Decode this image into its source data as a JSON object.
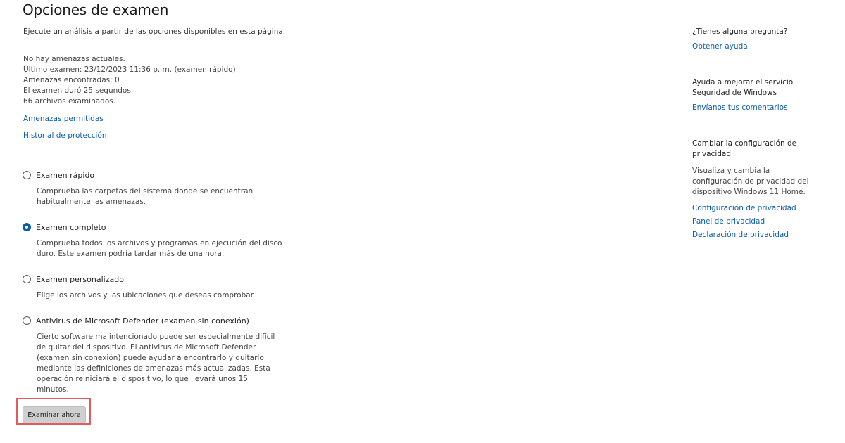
{
  "header": {
    "title": "Opciones de examen",
    "subtitle": "Ejecute un análisis a partir de las opciones disponibles en esta página."
  },
  "status": {
    "lines": [
      "No hay amenazas actuales.",
      "Último examen: 23/12/2023 11:36 p. m. (examen rápido)",
      "Amenazas encontradas: 0",
      "El examen duró 25 segundos",
      "66 archivos examinados."
    ]
  },
  "links": {
    "allowed_threats": "Amenazas permitidas",
    "protection_history": "Historial de protección"
  },
  "scan_options": [
    {
      "label": "Examen rápido",
      "description": "Comprueba las carpetas del sistema donde se encuentran habitualmente las amenazas.",
      "selected": false
    },
    {
      "label": "Examen completo",
      "description": "Comprueba todos los archivos y programas en ejecución del disco duro. Este examen podría tardar más de una hora.",
      "selected": true
    },
    {
      "label": "Examen personalizado",
      "description": "Elige los archivos y las ubicaciones que deseas comprobar.",
      "selected": false
    },
    {
      "label": "Antivirus de MIcrosoft Defender (examen sin conexión)",
      "description": "Cierto software malintencionado puede ser especialmente difícil de quitar del dispositivo. El antivirus de Microsoft Defender (examen sin conexión) puede ayudar a encontrarlo y quitarlo mediante las definiciones de amenazas más actualizadas. Esta operación reiniciará el dispositivo, lo que llevará unos 15 minutos.",
      "selected": false
    }
  ],
  "actions": {
    "scan_now": "Examinar ahora"
  },
  "sidebar": {
    "question": {
      "heading": "¿Tienes alguna pregunta?",
      "link": "Obtener ayuda"
    },
    "feedback": {
      "heading": "Ayuda a mejorar el servicio Seguridad de Windows",
      "link": "Envíanos tus comentarios"
    },
    "privacy": {
      "heading": "Cambiar la configuración de privacidad",
      "text": "Visualiza y cambia la configuración de privacidad del dispositivo Windows 11 Home.",
      "links": [
        "Configuración de privacidad",
        "Panel de privacidad",
        "Declaración de privacidad"
      ]
    }
  },
  "colors": {
    "accent": "#0b5cad",
    "highlight_frame": "#e05a60",
    "button_bg": "#cfcfcf"
  }
}
